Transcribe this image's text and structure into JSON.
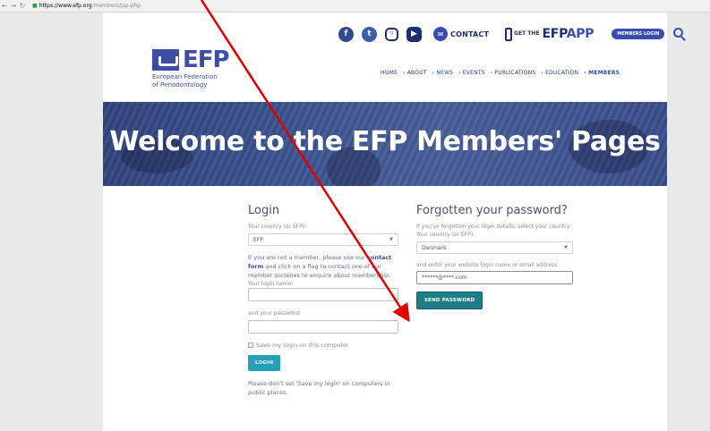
{
  "browser": {
    "url_host": "https://www.efp.org",
    "url_path": "/members/jsp.php"
  },
  "header": {
    "contact_label": "CONTACT",
    "app_get_the": "GET THE",
    "app_name_1": "EFP",
    "app_name_2": "APP",
    "members_login_label": "MEMBERS LOGIN"
  },
  "logo": {
    "letters": "EFP",
    "subtitle_line1": "European Federation",
    "subtitle_line2": "of Periodontology"
  },
  "nav": {
    "items": [
      "HOME",
      "› ABOUT",
      "› NEWS",
      "› EVENTS",
      "› PUBLICATIONS",
      "› EDUCATION",
      "› MEMBERS"
    ]
  },
  "banner": {
    "title": "Welcome to the EFP Members' Pages"
  },
  "login": {
    "heading": "Login",
    "country_label": "Your country (or EFP):",
    "country_value": "EFP",
    "info_1": "If you are not a member, please use our",
    "info_link": "contact form",
    "info_2": " and click on a flag to contact one of our member societies to enquire about membership.",
    "login_name_label": "Your login name:",
    "password_label": "and your password:",
    "save_login_label": "Save my login on this computer",
    "login_button": "LOGIN",
    "note": "Please don't set 'Save my login' on computers in public places."
  },
  "forgot": {
    "heading": "Forgotten your password?",
    "intro": "If you've forgotten your login details, select your country:",
    "country_label": "Your country (or EFP):",
    "country_value": "Denmark",
    "email_label": "and enter your website login name or email address:",
    "email_value": "******@****.com",
    "send_button": "SEND PASSWORD"
  },
  "colors": {
    "brand": "#3c4ea6",
    "teal_button": "#24a0b8",
    "arrow": "#e00000"
  }
}
